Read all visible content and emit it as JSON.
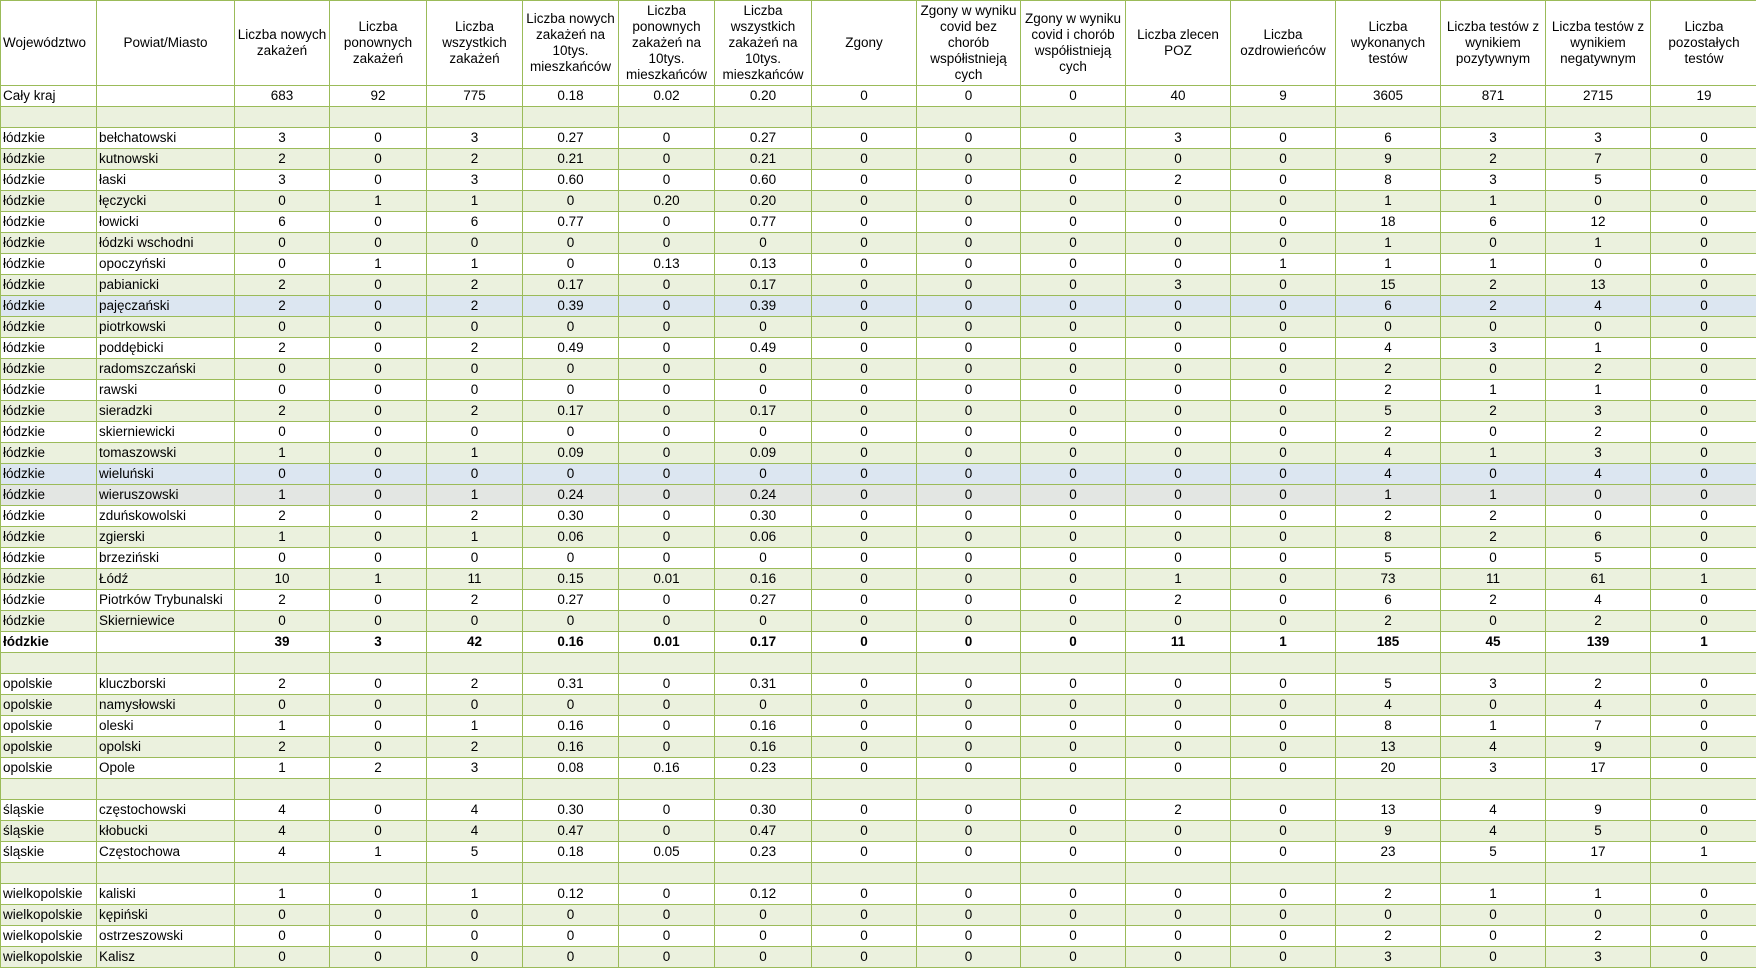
{
  "headers": [
    "Województwo",
    "Powiat/Miasto",
    "Liczba nowych zakażeń",
    "Liczba ponownych zakażeń",
    "Liczba wszystkich zakażeń",
    "Liczba nowych zakażeń na 10tys. mieszkańców",
    "Liczba ponownych zakażeń na 10tys. mieszkańców",
    "Liczba wszystkich zakażeń na 10tys. mieszkańców",
    "Zgony",
    "Zgony w wyniku covid bez chorób współistnieją cych",
    "Zgony w wyniku covid i chorób współistnieją cych",
    "Liczba zlecen POZ",
    "Liczba ozdrowieńców",
    "Liczba wykonanych testów",
    "Liczba testów z wynikiem pozytywnym",
    "Liczba testów z wynikiem negatywnym",
    "Liczba pozostałych testów"
  ],
  "rows": [
    {
      "type": "data",
      "cells": [
        "Cały kraj",
        "",
        "683",
        "92",
        "775",
        "0.18",
        "0.02",
        "0.20",
        "0",
        "0",
        "0",
        "40",
        "9",
        "3605",
        "871",
        "2715",
        "19"
      ]
    },
    {
      "type": "blank"
    },
    {
      "type": "data",
      "cells": [
        "łódzkie",
        "bełchatowski",
        "3",
        "0",
        "3",
        "0.27",
        "0",
        "0.27",
        "0",
        "0",
        "0",
        "3",
        "0",
        "6",
        "3",
        "3",
        "0"
      ]
    },
    {
      "type": "data",
      "cells": [
        "łódzkie",
        "kutnowski",
        "2",
        "0",
        "2",
        "0.21",
        "0",
        "0.21",
        "0",
        "0",
        "0",
        "0",
        "0",
        "9",
        "2",
        "7",
        "0"
      ]
    },
    {
      "type": "data",
      "cells": [
        "łódzkie",
        "łaski",
        "3",
        "0",
        "3",
        "0.60",
        "0",
        "0.60",
        "0",
        "0",
        "0",
        "2",
        "0",
        "8",
        "3",
        "5",
        "0"
      ]
    },
    {
      "type": "data",
      "cells": [
        "łódzkie",
        "łęczycki",
        "0",
        "1",
        "1",
        "0",
        "0.20",
        "0.20",
        "0",
        "0",
        "0",
        "0",
        "0",
        "1",
        "1",
        "0",
        "0"
      ]
    },
    {
      "type": "data",
      "cells": [
        "łódzkie",
        "łowicki",
        "6",
        "0",
        "6",
        "0.77",
        "0",
        "0.77",
        "0",
        "0",
        "0",
        "0",
        "0",
        "18",
        "6",
        "12",
        "0"
      ]
    },
    {
      "type": "data",
      "cells": [
        "łódzkie",
        "łódzki wschodni",
        "0",
        "0",
        "0",
        "0",
        "0",
        "0",
        "0",
        "0",
        "0",
        "0",
        "0",
        "1",
        "0",
        "1",
        "0"
      ]
    },
    {
      "type": "data",
      "cells": [
        "łódzkie",
        "opoczyński",
        "0",
        "1",
        "1",
        "0",
        "0.13",
        "0.13",
        "0",
        "0",
        "0",
        "0",
        "1",
        "1",
        "1",
        "0",
        "0"
      ]
    },
    {
      "type": "data",
      "cells": [
        "łódzkie",
        "pabianicki",
        "2",
        "0",
        "2",
        "0.17",
        "0",
        "0.17",
        "0",
        "0",
        "0",
        "3",
        "0",
        "15",
        "2",
        "13",
        "0"
      ]
    },
    {
      "type": "data",
      "hl": "blue",
      "cells": [
        "łódzkie",
        "pajęczański",
        "2",
        "0",
        "2",
        "0.39",
        "0",
        "0.39",
        "0",
        "0",
        "0",
        "0",
        "0",
        "6",
        "2",
        "4",
        "0"
      ]
    },
    {
      "type": "data",
      "cells": [
        "łódzkie",
        "piotrkowski",
        "0",
        "0",
        "0",
        "0",
        "0",
        "0",
        "0",
        "0",
        "0",
        "0",
        "0",
        "0",
        "0",
        "0",
        "0"
      ]
    },
    {
      "type": "data",
      "cells": [
        "łódzkie",
        "poddębicki",
        "2",
        "0",
        "2",
        "0.49",
        "0",
        "0.49",
        "0",
        "0",
        "0",
        "0",
        "0",
        "4",
        "3",
        "1",
        "0"
      ]
    },
    {
      "type": "data",
      "cells": [
        "łódzkie",
        "radomszczański",
        "0",
        "0",
        "0",
        "0",
        "0",
        "0",
        "0",
        "0",
        "0",
        "0",
        "0",
        "2",
        "0",
        "2",
        "0"
      ]
    },
    {
      "type": "data",
      "cells": [
        "łódzkie",
        "rawski",
        "0",
        "0",
        "0",
        "0",
        "0",
        "0",
        "0",
        "0",
        "0",
        "0",
        "0",
        "2",
        "1",
        "1",
        "0"
      ]
    },
    {
      "type": "data",
      "cells": [
        "łódzkie",
        "sieradzki",
        "2",
        "0",
        "2",
        "0.17",
        "0",
        "0.17",
        "0",
        "0",
        "0",
        "0",
        "0",
        "5",
        "2",
        "3",
        "0"
      ]
    },
    {
      "type": "data",
      "cells": [
        "łódzkie",
        "skierniewicki",
        "0",
        "0",
        "0",
        "0",
        "0",
        "0",
        "0",
        "0",
        "0",
        "0",
        "0",
        "2",
        "0",
        "2",
        "0"
      ]
    },
    {
      "type": "data",
      "cells": [
        "łódzkie",
        "tomaszowski",
        "1",
        "0",
        "1",
        "0.09",
        "0",
        "0.09",
        "0",
        "0",
        "0",
        "0",
        "0",
        "4",
        "1",
        "3",
        "0"
      ]
    },
    {
      "type": "data",
      "hl": "blue",
      "cells": [
        "łódzkie",
        "wieluński",
        "0",
        "0",
        "0",
        "0",
        "0",
        "0",
        "0",
        "0",
        "0",
        "0",
        "0",
        "4",
        "0",
        "4",
        "0"
      ]
    },
    {
      "type": "data",
      "hl": "grey",
      "cells": [
        "łódzkie",
        "wieruszowski",
        "1",
        "0",
        "1",
        "0.24",
        "0",
        "0.24",
        "0",
        "0",
        "0",
        "0",
        "0",
        "1",
        "1",
        "0",
        "0"
      ]
    },
    {
      "type": "data",
      "cells": [
        "łódzkie",
        "zduńskowolski",
        "2",
        "0",
        "2",
        "0.30",
        "0",
        "0.30",
        "0",
        "0",
        "0",
        "0",
        "0",
        "2",
        "2",
        "0",
        "0"
      ]
    },
    {
      "type": "data",
      "cells": [
        "łódzkie",
        "zgierski",
        "1",
        "0",
        "1",
        "0.06",
        "0",
        "0.06",
        "0",
        "0",
        "0",
        "0",
        "0",
        "8",
        "2",
        "6",
        "0"
      ]
    },
    {
      "type": "data",
      "cells": [
        "łódzkie",
        "brzeziński",
        "0",
        "0",
        "0",
        "0",
        "0",
        "0",
        "0",
        "0",
        "0",
        "0",
        "0",
        "5",
        "0",
        "5",
        "0"
      ]
    },
    {
      "type": "data",
      "cells": [
        "łódzkie",
        "Łódź",
        "10",
        "1",
        "11",
        "0.15",
        "0.01",
        "0.16",
        "0",
        "0",
        "0",
        "1",
        "0",
        "73",
        "11",
        "61",
        "1"
      ]
    },
    {
      "type": "data",
      "cells": [
        "łódzkie",
        "Piotrków Trybunalski",
        "2",
        "0",
        "2",
        "0.27",
        "0",
        "0.27",
        "0",
        "0",
        "0",
        "2",
        "0",
        "6",
        "2",
        "4",
        "0"
      ]
    },
    {
      "type": "data",
      "cells": [
        "łódzkie",
        "Skierniewice",
        "0",
        "0",
        "0",
        "0",
        "0",
        "0",
        "0",
        "0",
        "0",
        "0",
        "0",
        "2",
        "0",
        "2",
        "0"
      ]
    },
    {
      "type": "total",
      "cells": [
        "łódzkie",
        "",
        "39",
        "3",
        "42",
        "0.16",
        "0.01",
        "0.17",
        "0",
        "0",
        "0",
        "11",
        "1",
        "185",
        "45",
        "139",
        "1"
      ]
    },
    {
      "type": "blank"
    },
    {
      "type": "data",
      "cells": [
        "opolskie",
        "kluczborski",
        "2",
        "0",
        "2",
        "0.31",
        "0",
        "0.31",
        "0",
        "0",
        "0",
        "0",
        "0",
        "5",
        "3",
        "2",
        "0"
      ]
    },
    {
      "type": "data",
      "cells": [
        "opolskie",
        "namysłowski",
        "0",
        "0",
        "0",
        "0",
        "0",
        "0",
        "0",
        "0",
        "0",
        "0",
        "0",
        "4",
        "0",
        "4",
        "0"
      ]
    },
    {
      "type": "data",
      "cells": [
        "opolskie",
        "oleski",
        "1",
        "0",
        "1",
        "0.16",
        "0",
        "0.16",
        "0",
        "0",
        "0",
        "0",
        "0",
        "8",
        "1",
        "7",
        "0"
      ]
    },
    {
      "type": "data",
      "cells": [
        "opolskie",
        "opolski",
        "2",
        "0",
        "2",
        "0.16",
        "0",
        "0.16",
        "0",
        "0",
        "0",
        "0",
        "0",
        "13",
        "4",
        "9",
        "0"
      ]
    },
    {
      "type": "data",
      "cells": [
        "opolskie",
        "Opole",
        "1",
        "2",
        "3",
        "0.08",
        "0.16",
        "0.23",
        "0",
        "0",
        "0",
        "0",
        "0",
        "20",
        "3",
        "17",
        "0"
      ]
    },
    {
      "type": "blank"
    },
    {
      "type": "data",
      "cells": [
        "śląskie",
        "częstochowski",
        "4",
        "0",
        "4",
        "0.30",
        "0",
        "0.30",
        "0",
        "0",
        "0",
        "2",
        "0",
        "13",
        "4",
        "9",
        "0"
      ]
    },
    {
      "type": "data",
      "cells": [
        "śląskie",
        "kłobucki",
        "4",
        "0",
        "4",
        "0.47",
        "0",
        "0.47",
        "0",
        "0",
        "0",
        "0",
        "0",
        "9",
        "4",
        "5",
        "0"
      ]
    },
    {
      "type": "data",
      "cells": [
        "śląskie",
        "Częstochowa",
        "4",
        "1",
        "5",
        "0.18",
        "0.05",
        "0.23",
        "0",
        "0",
        "0",
        "0",
        "0",
        "23",
        "5",
        "17",
        "1"
      ]
    },
    {
      "type": "blank"
    },
    {
      "type": "data",
      "cells": [
        "wielkopolskie",
        "kaliski",
        "1",
        "0",
        "1",
        "0.12",
        "0",
        "0.12",
        "0",
        "0",
        "0",
        "0",
        "0",
        "2",
        "1",
        "1",
        "0"
      ]
    },
    {
      "type": "data",
      "cells": [
        "wielkopolskie",
        "kępiński",
        "0",
        "0",
        "0",
        "0",
        "0",
        "0",
        "0",
        "0",
        "0",
        "0",
        "0",
        "0",
        "0",
        "0",
        "0"
      ]
    },
    {
      "type": "data",
      "cells": [
        "wielkopolskie",
        "ostrzeszowski",
        "0",
        "0",
        "0",
        "0",
        "0",
        "0",
        "0",
        "0",
        "0",
        "0",
        "0",
        "2",
        "0",
        "2",
        "0"
      ]
    },
    {
      "type": "data",
      "cells": [
        "wielkopolskie",
        "Kalisz",
        "0",
        "0",
        "0",
        "0",
        "0",
        "0",
        "0",
        "0",
        "0",
        "0",
        "0",
        "3",
        "0",
        "3",
        "0"
      ]
    }
  ],
  "colors": {
    "grid": "#9bbb59",
    "band": "#ebf1de",
    "white": "#ffffff",
    "highlight_blue": "#dce6f1",
    "highlight_grey": "#e3e6e3"
  }
}
